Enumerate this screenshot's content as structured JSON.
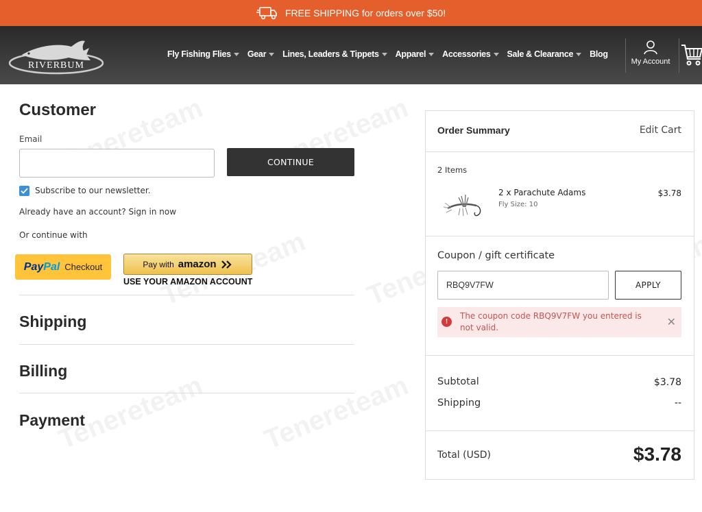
{
  "promo": {
    "text": "FREE SHIPPING for orders over $50!"
  },
  "header": {
    "logo_text": "RIVERBUM",
    "nav": [
      {
        "label": "Fly Fishing Flies",
        "dropdown": true
      },
      {
        "label": "Gear",
        "dropdown": true
      },
      {
        "label": "Lines, Leaders & Tippets",
        "dropdown": true
      },
      {
        "label": "Apparel",
        "dropdown": true
      },
      {
        "label": "Accessories",
        "dropdown": true
      },
      {
        "label": "Sale & Clearance",
        "dropdown": true
      },
      {
        "label": "Blog",
        "dropdown": false
      }
    ],
    "account_label": "My Account"
  },
  "customer": {
    "title": "Customer",
    "email_label": "Email",
    "email_value": "",
    "continue_label": "CONTINUE",
    "newsletter_label": "Subscribe to our newsletter.",
    "newsletter_checked": true,
    "signin_prefix": "Already have an account?",
    "signin_link": "Sign in now",
    "or_continue": "Or continue with",
    "paypal_pay": "Pay",
    "paypal_pal": "Pal",
    "paypal_checkout": "Checkout",
    "amazon_pay_with": "Pay with",
    "amazon_word": "amazon",
    "amazon_sub": "USE YOUR AMAZON ACCOUNT"
  },
  "sections": {
    "shipping": "Shipping",
    "billing": "Billing",
    "payment": "Payment"
  },
  "summary": {
    "title": "Order Summary",
    "edit_cart": "Edit Cart",
    "items_count": "2 Items",
    "item": {
      "name": "2 x Parachute Adams",
      "option": "Fly Size: 10",
      "price": "$3.78"
    },
    "coupon_title": "Coupon / gift certificate",
    "coupon_value": "RBQ9V7FW",
    "apply_label": "APPLY",
    "error_text": "The coupon code RBQ9V7FW you entered is not valid.",
    "subtotal_label": "Subtotal",
    "subtotal_value": "$3.78",
    "shipping_label": "Shipping",
    "shipping_value": "--",
    "total_label": "Total (USD)",
    "total_value": "$3.78"
  },
  "colors": {
    "promo_bg": "#e45f2b",
    "header_bg": "#333333",
    "button_dark": "#333333",
    "paypal_yellow": "#ffc439",
    "error_bg": "#fbe9e9",
    "error_text": "#c2554f",
    "checkbox_blue": "#3d8fd8"
  },
  "watermark": "Tenereteam"
}
